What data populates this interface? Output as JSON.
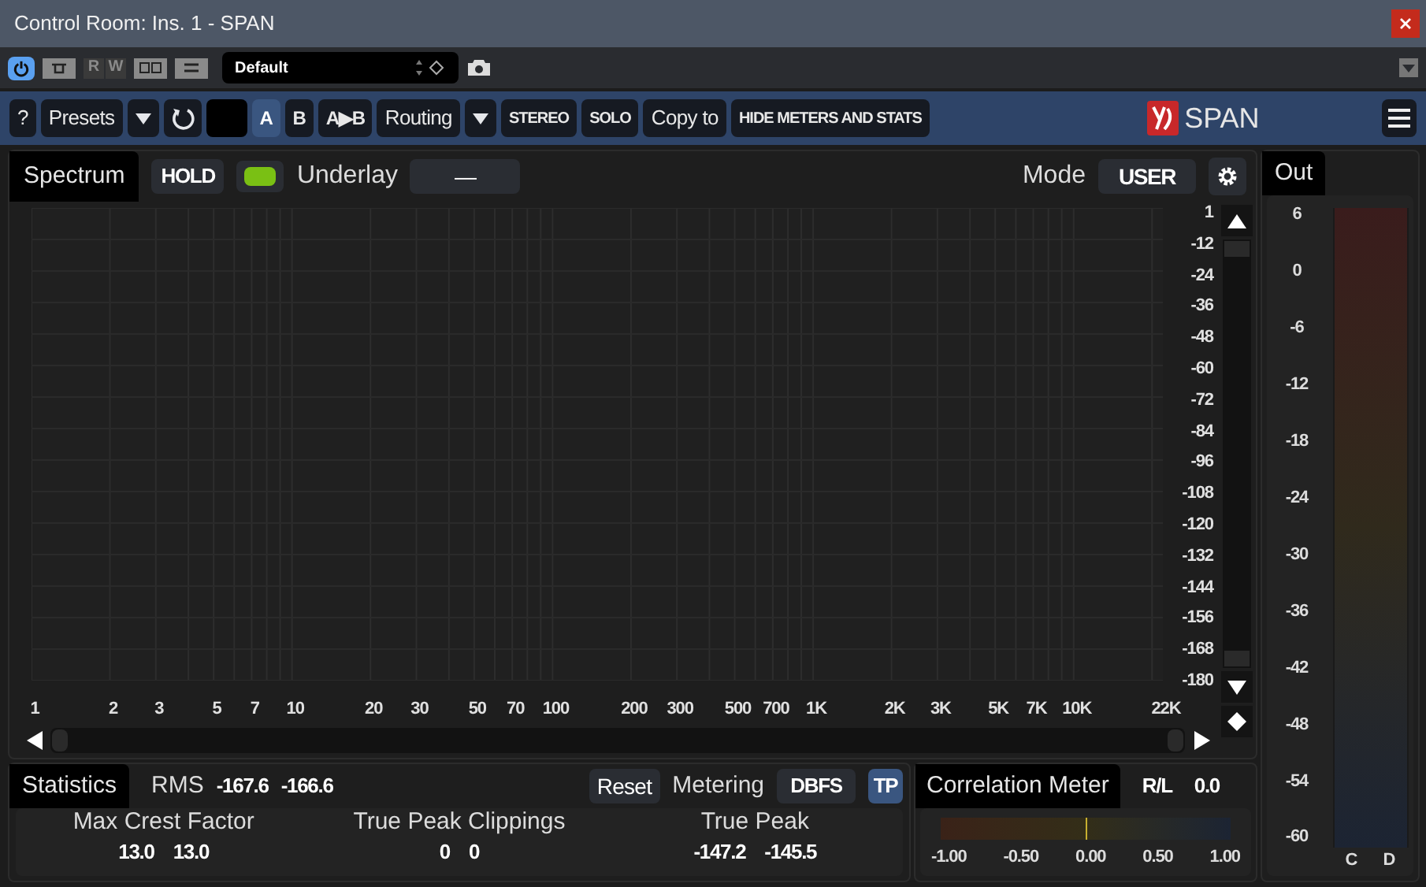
{
  "window": {
    "title": "Control Room: Ins. 1 - SPAN"
  },
  "host_toolbar": {
    "power_on": true,
    "rw_buttons": [
      {
        "label": "R",
        "disabled": true
      },
      {
        "label": "W",
        "disabled": true
      }
    ],
    "preset": "Default"
  },
  "plugin_toolbar": {
    "items": [
      {
        "kind": "button",
        "label": "?"
      },
      {
        "kind": "button",
        "label": "Presets"
      },
      {
        "kind": "dropdown"
      },
      {
        "kind": "undo"
      },
      {
        "kind": "blank"
      },
      {
        "kind": "ab",
        "label": "A",
        "selected": true
      },
      {
        "kind": "ab",
        "label": "B",
        "selected": false
      },
      {
        "kind": "ab",
        "label": "A▶B",
        "selected": false
      },
      {
        "kind": "button",
        "label": "Routing"
      },
      {
        "kind": "dropdown"
      },
      {
        "kind": "caps",
        "label": "STEREO"
      },
      {
        "kind": "caps",
        "label": "SOLO"
      },
      {
        "kind": "button",
        "label": "Copy to"
      },
      {
        "kind": "caps",
        "label": "HIDE METERS AND STATS"
      }
    ],
    "logo": "SPAN"
  },
  "spectrum": {
    "tab": "Spectrum",
    "hold": "HOLD",
    "hold_on": true,
    "underlay_label": "Underlay",
    "underlay_value": "—",
    "mode_label": "Mode",
    "mode_value": "USER",
    "db_labels": [
      "1",
      "-12",
      "-24",
      "-36",
      "-48",
      "-60",
      "-72",
      "-84",
      "-96",
      "-108",
      "-120",
      "-132",
      "-144",
      "-156",
      "-168",
      "-180"
    ],
    "freq_labels": [
      "1",
      "2",
      "3",
      "5",
      "7",
      "10",
      "20",
      "30",
      "50",
      "70",
      "100",
      "200",
      "300",
      "500",
      "700",
      "1K",
      "2K",
      "3K",
      "5K",
      "7K",
      "10K",
      "22K"
    ]
  },
  "statistics": {
    "tab": "Statistics",
    "rms_label": "RMS",
    "rms_values": [
      "-167.6",
      "-166.6"
    ],
    "reset": "Reset",
    "metering_label": "Metering",
    "metering_value": "DBFS",
    "tp": "TP",
    "tp_on": true,
    "groups": [
      {
        "label": "Max Crest Factor",
        "values": [
          "13.0",
          "13.0"
        ]
      },
      {
        "label": "True Peak Clippings",
        "values": [
          "0",
          "0"
        ]
      },
      {
        "label": "True Peak",
        "values": [
          "-147.2",
          "-145.5"
        ]
      }
    ]
  },
  "correlation": {
    "tab": "Correlation Meter",
    "mode": "R/L",
    "value": "0.0",
    "level": 0.5,
    "scale": [
      "-1.00",
      "-0.50",
      "0.00",
      "0.50",
      "1.00"
    ]
  },
  "out": {
    "tab": "Out",
    "scale": [
      "6",
      "0",
      "-6",
      "-12",
      "-18",
      "-24",
      "-30",
      "-36",
      "-42",
      "-48",
      "-54",
      "-60"
    ],
    "channels": [
      "C",
      "D"
    ]
  }
}
